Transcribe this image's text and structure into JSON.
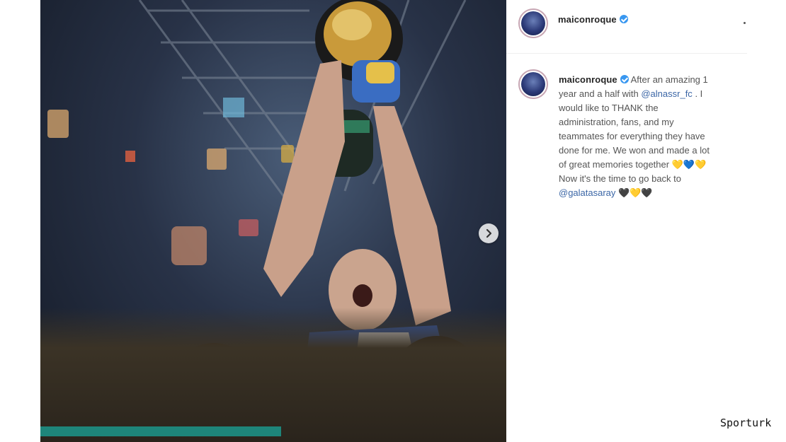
{
  "post": {
    "username": "maiconroque",
    "caption_lines": [
      "After an amazing 1",
      "year and a half with",
      "@alnassr_fc",
      ". I",
      "would like to THANK the",
      "administration, fans, and my",
      "teammates for everything they have",
      "done for me. We won and made a lot",
      "of great memories together",
      "Now it's the time to go back to",
      "@galatasaray"
    ],
    "hearts_line1": [
      "💛",
      "💙",
      "💛"
    ],
    "hearts_line2": [
      "🖤",
      "💛",
      "🖤"
    ]
  },
  "icons": {
    "verified": "verified-badge-icon",
    "next": "chevron-right-icon"
  },
  "colors": {
    "mention": "#3b66a6",
    "verified": "#3897f0"
  },
  "watermark": "Sporturk"
}
